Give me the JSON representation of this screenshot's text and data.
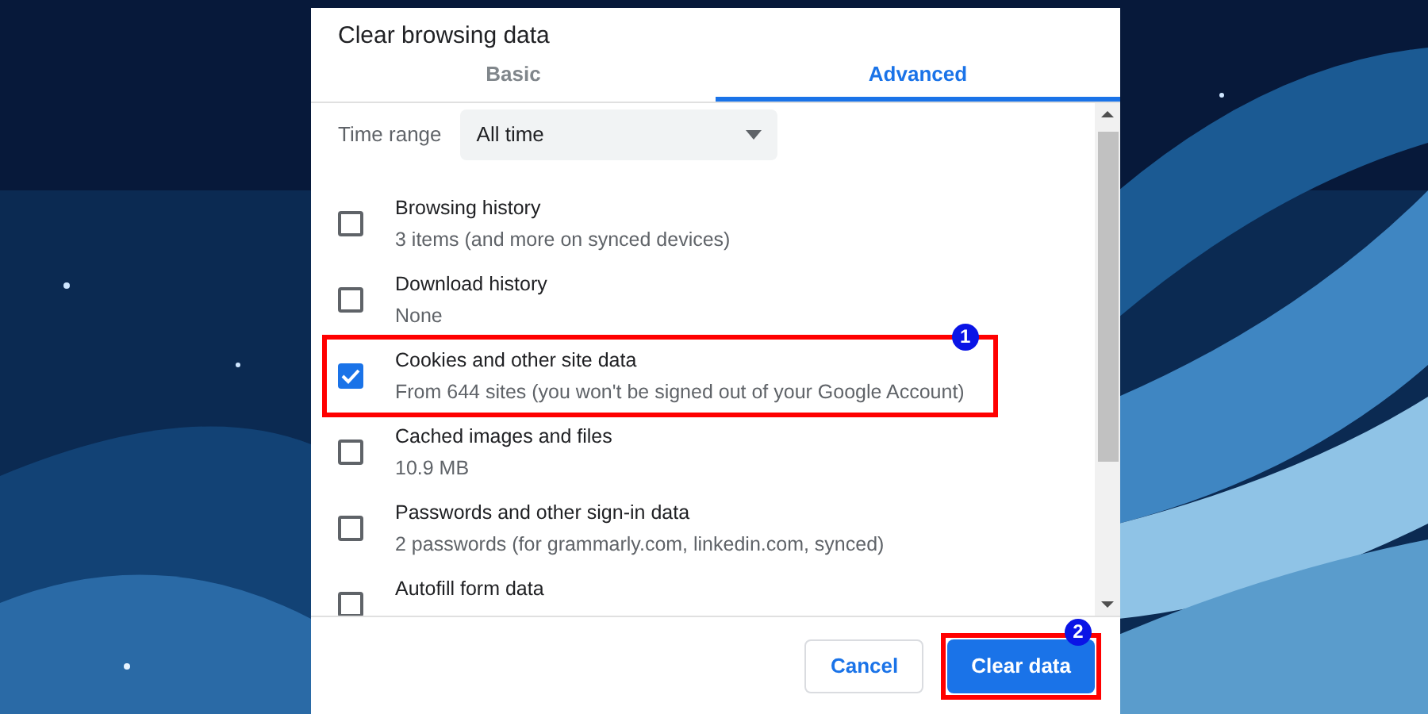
{
  "dialog": {
    "title": "Clear browsing data",
    "tabs": [
      {
        "label": "Basic",
        "selected": false
      },
      {
        "label": "Advanced",
        "selected": true
      }
    ],
    "time_range": {
      "label": "Time range",
      "value": "All time"
    },
    "items": [
      {
        "title": "Browsing history",
        "detail": "3 items (and more on synced devices)",
        "checked": false
      },
      {
        "title": "Download history",
        "detail": "None",
        "checked": false
      },
      {
        "title": "Cookies and other site data",
        "detail": "From 644 sites (you won't be signed out of your Google Account)",
        "checked": true,
        "callout": "1"
      },
      {
        "title": "Cached images and files",
        "detail": "10.9 MB",
        "checked": false
      },
      {
        "title": "Passwords and other sign-in data",
        "detail": "2 passwords (for grammarly.com, linkedin.com, synced)",
        "checked": false
      },
      {
        "title": "Autofill form data",
        "checked": false
      }
    ],
    "buttons": [
      {
        "label": "Cancel",
        "kind": "secondary"
      },
      {
        "label": "Clear data",
        "kind": "primary",
        "callout": "2"
      }
    ]
  }
}
